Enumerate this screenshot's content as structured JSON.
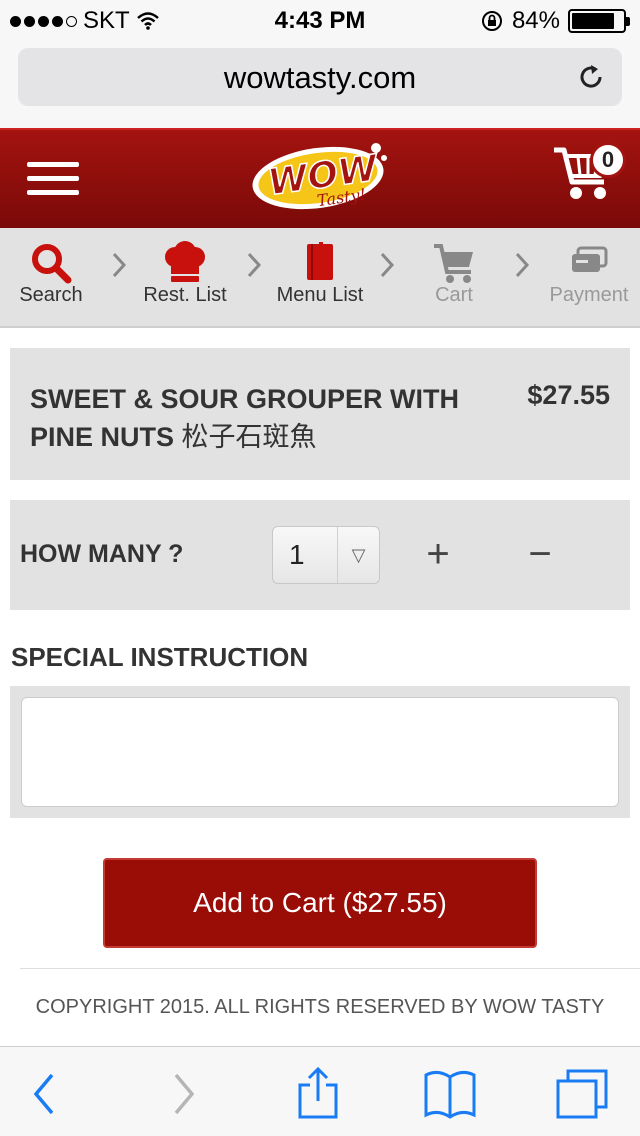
{
  "status_bar": {
    "carrier": "SKT",
    "time": "4:43 PM",
    "battery_text": "84%",
    "battery_level": 0.84,
    "signal_bars": 4
  },
  "browser": {
    "url": "wowtasty.com"
  },
  "header": {
    "cart_count": "0",
    "logo_icon": "wow-tasty-logo"
  },
  "steps": [
    {
      "label": "Search",
      "icon": "search-icon",
      "active": true
    },
    {
      "label": "Rest. List",
      "icon": "chef-hat-icon",
      "active": true
    },
    {
      "label": "Menu List",
      "icon": "menu-book-icon",
      "active": true
    },
    {
      "label": "Cart",
      "icon": "cart-icon",
      "active": false
    },
    {
      "label": "Payment",
      "icon": "payment-icon",
      "active": false
    }
  ],
  "item": {
    "name": "SWEET & SOUR GROUPER WITH PINE NUTS",
    "name_cn": "松子石斑魚",
    "price": "$27.55"
  },
  "quantity": {
    "label": "HOW MANY ?",
    "value": "1",
    "plus": "+",
    "minus": "−"
  },
  "special": {
    "title": "SPECIAL INSTRUCTION",
    "value": ""
  },
  "add_to_cart": "Add to Cart ($27.55)",
  "copyright": "COPYRIGHT 2015. ALL RIGHTS RESERVED BY WOW TASTY",
  "colors": {
    "brand_red": "#9a0d07",
    "step_active_icon": "#c8100c",
    "step_inactive_icon": "#888888",
    "ios_blue": "#1a7cf5"
  }
}
